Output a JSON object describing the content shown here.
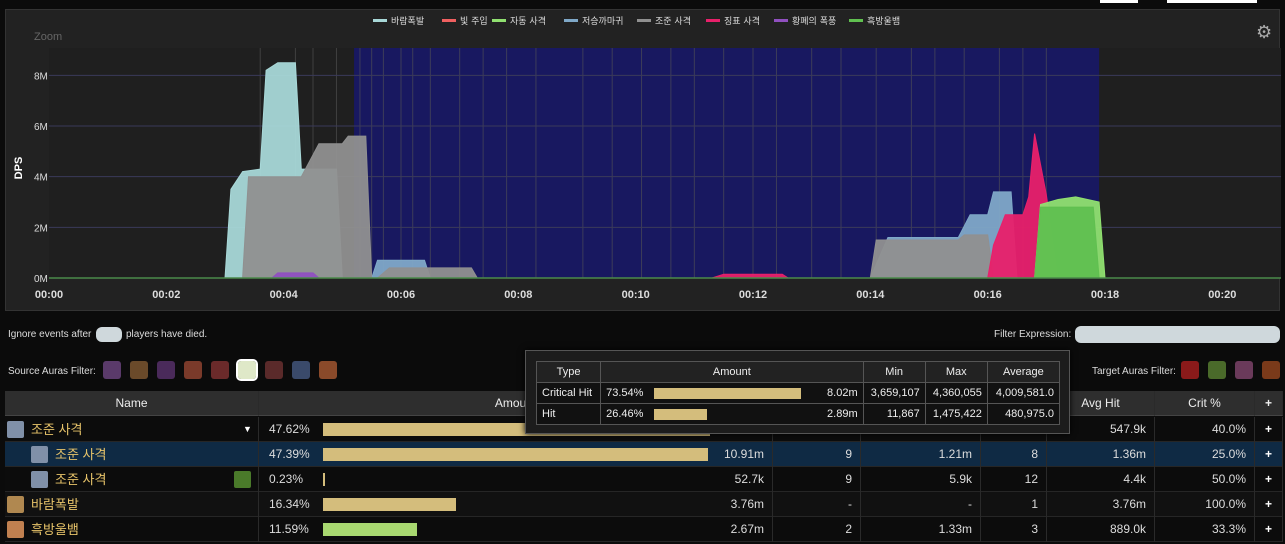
{
  "chart": {
    "zoom_label": "Zoom",
    "y_axis_label": "DPS",
    "y_ticks": [
      "8M",
      "6M",
      "4M",
      "2M",
      "0M"
    ],
    "x_ticks": [
      "00:00",
      "00:02",
      "00:04",
      "00:06",
      "00:08",
      "00:10",
      "00:12",
      "00:14",
      "00:16",
      "00:18",
      "00:20"
    ],
    "legend": [
      {
        "label": "바람폭발",
        "color": "#a8d8d8"
      },
      {
        "label": "빛 주입",
        "color": "#f06060"
      },
      {
        "label": "자동 사격",
        "color": "#90e070"
      },
      {
        "label": "저승까마귀",
        "color": "#7fa8c8"
      },
      {
        "label": "조준 사격",
        "color": "#909090"
      },
      {
        "label": "징표 사격",
        "color": "#e8206a"
      },
      {
        "label": "황폐의 폭풍",
        "color": "#9050c0"
      },
      {
        "label": "흑방울뱀",
        "color": "#60c050"
      }
    ],
    "plot_bg": "#181860"
  },
  "chart_data": {
    "type": "area",
    "title": "",
    "xlabel": "",
    "ylabel": "DPS",
    "xlim": [
      "00:00",
      "00:21"
    ],
    "ylim": [
      0,
      9000000
    ],
    "x_ticks": [
      "00:00",
      "00:02",
      "00:04",
      "00:06",
      "00:08",
      "00:10",
      "00:12",
      "00:14",
      "00:16",
      "00:18",
      "00:20"
    ],
    "y_ticks": [
      "0M",
      "2M",
      "4M",
      "6M",
      "8M"
    ],
    "legend_position": "top",
    "series": [
      {
        "name": "바람폭발",
        "color": "#a8d8d8",
        "points": [
          [
            3.0,
            0
          ],
          [
            3.1,
            3500000
          ],
          [
            3.3,
            4200000
          ],
          [
            3.6,
            4300000
          ],
          [
            3.7,
            8200000
          ],
          [
            3.9,
            8500000
          ],
          [
            4.2,
            8500000
          ],
          [
            4.3,
            4300000
          ],
          [
            4.9,
            4300000
          ],
          [
            5.0,
            0
          ]
        ]
      },
      {
        "name": "저승까마귀",
        "color": "#7fa8c8",
        "points": [
          [
            5.5,
            0
          ],
          [
            5.6,
            700000
          ],
          [
            6.4,
            700000
          ],
          [
            6.5,
            0
          ],
          [
            14.0,
            0
          ],
          [
            14.3,
            1600000
          ],
          [
            15.5,
            1600000
          ],
          [
            15.7,
            2500000
          ],
          [
            16.0,
            2500000
          ],
          [
            16.1,
            3400000
          ],
          [
            16.4,
            3400000
          ],
          [
            16.5,
            0
          ]
        ]
      },
      {
        "name": "조준 사격",
        "color": "#909090",
        "points": [
          [
            3.3,
            0
          ],
          [
            3.4,
            4000000
          ],
          [
            4.3,
            4000000
          ],
          [
            4.6,
            5300000
          ],
          [
            5.0,
            5300000
          ],
          [
            5.1,
            5600000
          ],
          [
            5.4,
            5600000
          ],
          [
            5.5,
            0
          ],
          [
            5.6,
            0
          ],
          [
            5.8,
            400000
          ],
          [
            7.2,
            400000
          ],
          [
            7.3,
            0
          ],
          [
            14.0,
            0
          ],
          [
            14.1,
            1500000
          ],
          [
            15.5,
            1500000
          ],
          [
            15.6,
            1700000
          ],
          [
            16.0,
            1700000
          ],
          [
            16.1,
            0
          ]
        ]
      },
      {
        "name": "징표 사격",
        "color": "#e8206a",
        "points": [
          [
            11.3,
            0
          ],
          [
            11.5,
            150000
          ],
          [
            12.5,
            150000
          ],
          [
            12.6,
            0
          ],
          [
            16.0,
            0
          ],
          [
            16.1,
            1300000
          ],
          [
            16.3,
            2500000
          ],
          [
            16.6,
            2500000
          ],
          [
            16.7,
            3200000
          ],
          [
            16.8,
            5700000
          ],
          [
            17.0,
            3300000
          ],
          [
            17.2,
            0
          ]
        ]
      },
      {
        "name": "자동 사격",
        "color": "#90e070",
        "points": [
          [
            16.8,
            0
          ],
          [
            16.9,
            2900000
          ],
          [
            17.2,
            3100000
          ],
          [
            17.5,
            3200000
          ],
          [
            17.9,
            3000000
          ],
          [
            18.0,
            0
          ]
        ]
      },
      {
        "name": "황폐의 폭풍",
        "color": "#9050c0",
        "points": [
          [
            3.8,
            0
          ],
          [
            3.9,
            200000
          ],
          [
            4.5,
            200000
          ],
          [
            4.6,
            0
          ]
        ]
      },
      {
        "name": "흑방울뱀",
        "color": "#60c050",
        "points": [
          [
            16.8,
            0
          ],
          [
            16.9,
            2800000
          ],
          [
            17.8,
            2800000
          ],
          [
            17.9,
            0
          ]
        ]
      }
    ]
  },
  "filters": {
    "ignore_prefix": "Ignore events after",
    "ignore_suffix": "players have died.",
    "filter_expression_label": "Filter Expression:",
    "source_auras_label": "Source Auras Filter:",
    "target_auras_label": "Target Auras Filter:",
    "source_aura_colors": [
      "#5a3a6a",
      "#6a4a2a",
      "#4a2a5a",
      "#7a3a2a",
      "#6a2a2a",
      "#dfe8c8",
      "#5a2a2a",
      "#3a4a6a",
      "#8a4a2a"
    ],
    "target_aura_colors": [
      "#8a1a1a",
      "#4a6a2a",
      "#6a3a5a",
      "#7a3a1a"
    ]
  },
  "table": {
    "headers": {
      "name": "Name",
      "amount": "Amount",
      "avg_hit": "Avg Hit",
      "crit": "Crit %",
      "expand": "+"
    },
    "rows": [
      {
        "name": "조준 사격",
        "pct": "47.62%",
        "bar_fraction": 0.4762,
        "bar_color": "#d4bd7c",
        "amount": "",
        "casts": "",
        "avg_cast": "",
        "hits": "",
        "avg_hit": "547.9k",
        "crit": "40.0%",
        "dropdown": "▼",
        "icon_color": "#8090a8",
        "indent": false,
        "highlight": false
      },
      {
        "name": "조준 사격",
        "pct": "47.39%",
        "bar_fraction": 0.4739,
        "bar_color": "#d4bd7c",
        "amount": "10.91m",
        "casts": "9",
        "avg_cast": "1.21m",
        "hits": "8",
        "avg_hit": "1.36m",
        "crit": "25.0%",
        "dropdown": "",
        "icon_color": "#8090a8",
        "indent": true,
        "highlight": true
      },
      {
        "name": "조준 사격",
        "pct": "0.23%",
        "bar_fraction": 0.0023,
        "bar_color": "#d4bd7c",
        "amount": "52.7k",
        "casts": "9",
        "avg_cast": "5.9k",
        "hits": "12",
        "avg_hit": "4.4k",
        "crit": "50.0%",
        "dropdown": "",
        "icon_color": "#8090a8",
        "indent": true,
        "highlight": false
      },
      {
        "name": "바람폭발",
        "pct": "16.34%",
        "bar_fraction": 0.1634,
        "bar_color": "#d4bd7c",
        "amount": "3.76m",
        "casts": "-",
        "avg_cast": "-",
        "hits": "1",
        "avg_hit": "3.76m",
        "crit": "100.0%",
        "dropdown": "",
        "icon_color": "#b08850",
        "indent": false,
        "highlight": false
      },
      {
        "name": "흑방울뱀",
        "pct": "11.59%",
        "bar_fraction": 0.1159,
        "bar_color": "#a8d870",
        "amount": "2.67m",
        "casts": "2",
        "avg_cast": "1.33m",
        "hits": "3",
        "avg_hit": "889.0k",
        "crit": "33.3%",
        "dropdown": "",
        "icon_color": "#c08050",
        "indent": false,
        "highlight": false
      }
    ]
  },
  "tooltip": {
    "headers": {
      "type": "Type",
      "amount": "Amount",
      "min": "Min",
      "max": "Max",
      "average": "Average"
    },
    "rows": [
      {
        "type": "Critical Hit",
        "pct": "73.54%",
        "bar_fraction": 0.7354,
        "amount": "8.02m",
        "min": "3,659,107",
        "max": "4,360,055",
        "average": "4,009,581.0"
      },
      {
        "type": "Hit",
        "pct": "26.46%",
        "bar_fraction": 0.2646,
        "amount": "2.89m",
        "min": "11,867",
        "max": "1,475,422",
        "average": "480,975.0"
      }
    ]
  }
}
